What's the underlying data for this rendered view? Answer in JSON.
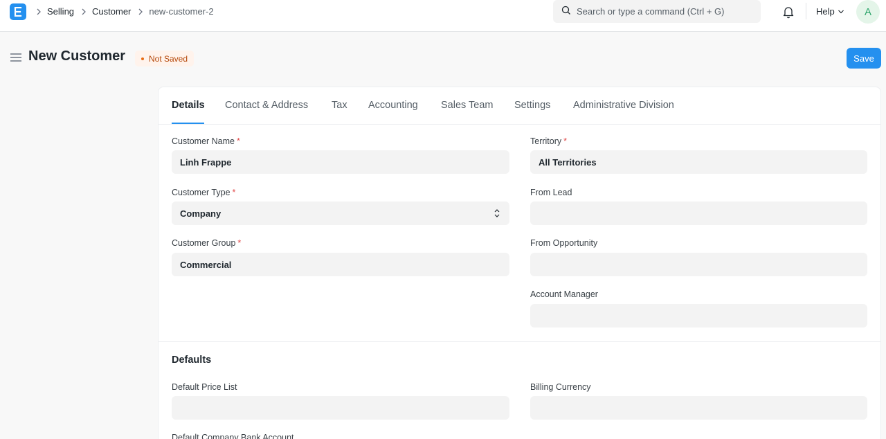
{
  "navbar": {
    "breadcrumbs": [
      "Selling",
      "Customer",
      "new-customer-2"
    ],
    "search_placeholder": "Search or type a command (Ctrl + G)",
    "help_label": "Help",
    "avatar_initial": "A"
  },
  "header": {
    "title": "New Customer",
    "status": "Not Saved",
    "save_label": "Save"
  },
  "tabs": [
    "Details",
    "Contact & Address",
    "Tax",
    "Accounting",
    "Sales Team",
    "Settings",
    "Administrative Division"
  ],
  "fields": {
    "customer_name": {
      "label": "Customer Name",
      "value": "Linh Frappe",
      "required": "*"
    },
    "customer_type": {
      "label": "Customer Type",
      "value": "Company",
      "required": "*"
    },
    "customer_group": {
      "label": "Customer Group",
      "value": "Commercial",
      "required": "*"
    },
    "territory": {
      "label": "Territory",
      "value": "All Territories",
      "required": "*"
    },
    "from_lead": {
      "label": "From Lead",
      "value": ""
    },
    "from_opportunity": {
      "label": "From Opportunity",
      "value": ""
    },
    "account_manager": {
      "label": "Account Manager",
      "value": ""
    }
  },
  "defaults": {
    "title": "Defaults",
    "default_price_list": {
      "label": "Default Price List",
      "value": ""
    },
    "billing_currency": {
      "label": "Billing Currency",
      "value": ""
    },
    "default_company_bank_account": {
      "label": "Default Company Bank Account"
    }
  },
  "colors": {
    "primary": "#2490ef",
    "required": "#e24c4c",
    "status_text": "#b54708",
    "status_bg": "#fff3ec"
  }
}
